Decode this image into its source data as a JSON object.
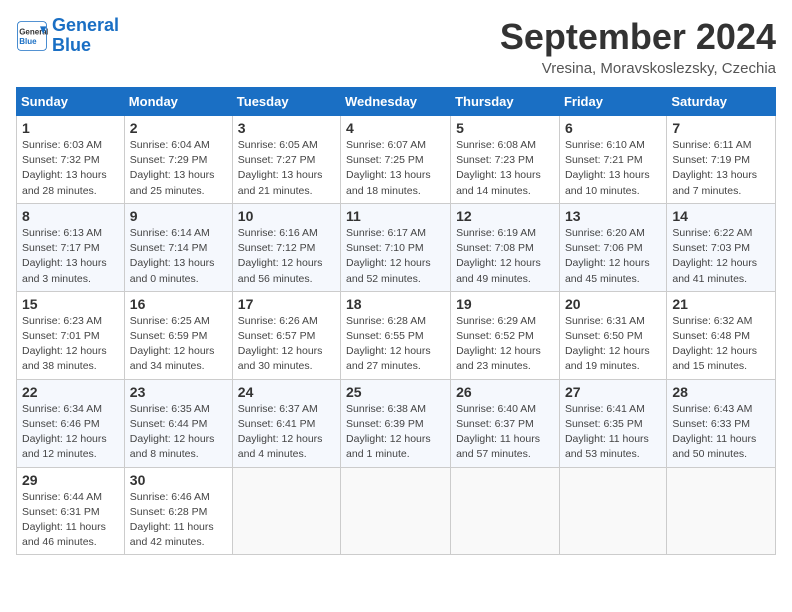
{
  "header": {
    "logo_line1": "General",
    "logo_line2": "Blue",
    "month_year": "September 2024",
    "location": "Vresina, Moravskoslezsky, Czechia"
  },
  "columns": [
    "Sunday",
    "Monday",
    "Tuesday",
    "Wednesday",
    "Thursday",
    "Friday",
    "Saturday"
  ],
  "weeks": [
    [
      {
        "day": "1",
        "info": "Sunrise: 6:03 AM\nSunset: 7:32 PM\nDaylight: 13 hours\nand 28 minutes."
      },
      {
        "day": "2",
        "info": "Sunrise: 6:04 AM\nSunset: 7:29 PM\nDaylight: 13 hours\nand 25 minutes."
      },
      {
        "day": "3",
        "info": "Sunrise: 6:05 AM\nSunset: 7:27 PM\nDaylight: 13 hours\nand 21 minutes."
      },
      {
        "day": "4",
        "info": "Sunrise: 6:07 AM\nSunset: 7:25 PM\nDaylight: 13 hours\nand 18 minutes."
      },
      {
        "day": "5",
        "info": "Sunrise: 6:08 AM\nSunset: 7:23 PM\nDaylight: 13 hours\nand 14 minutes."
      },
      {
        "day": "6",
        "info": "Sunrise: 6:10 AM\nSunset: 7:21 PM\nDaylight: 13 hours\nand 10 minutes."
      },
      {
        "day": "7",
        "info": "Sunrise: 6:11 AM\nSunset: 7:19 PM\nDaylight: 13 hours\nand 7 minutes."
      }
    ],
    [
      {
        "day": "8",
        "info": "Sunrise: 6:13 AM\nSunset: 7:17 PM\nDaylight: 13 hours\nand 3 minutes."
      },
      {
        "day": "9",
        "info": "Sunrise: 6:14 AM\nSunset: 7:14 PM\nDaylight: 13 hours\nand 0 minutes."
      },
      {
        "day": "10",
        "info": "Sunrise: 6:16 AM\nSunset: 7:12 PM\nDaylight: 12 hours\nand 56 minutes."
      },
      {
        "day": "11",
        "info": "Sunrise: 6:17 AM\nSunset: 7:10 PM\nDaylight: 12 hours\nand 52 minutes."
      },
      {
        "day": "12",
        "info": "Sunrise: 6:19 AM\nSunset: 7:08 PM\nDaylight: 12 hours\nand 49 minutes."
      },
      {
        "day": "13",
        "info": "Sunrise: 6:20 AM\nSunset: 7:06 PM\nDaylight: 12 hours\nand 45 minutes."
      },
      {
        "day": "14",
        "info": "Sunrise: 6:22 AM\nSunset: 7:03 PM\nDaylight: 12 hours\nand 41 minutes."
      }
    ],
    [
      {
        "day": "15",
        "info": "Sunrise: 6:23 AM\nSunset: 7:01 PM\nDaylight: 12 hours\nand 38 minutes."
      },
      {
        "day": "16",
        "info": "Sunrise: 6:25 AM\nSunset: 6:59 PM\nDaylight: 12 hours\nand 34 minutes."
      },
      {
        "day": "17",
        "info": "Sunrise: 6:26 AM\nSunset: 6:57 PM\nDaylight: 12 hours\nand 30 minutes."
      },
      {
        "day": "18",
        "info": "Sunrise: 6:28 AM\nSunset: 6:55 PM\nDaylight: 12 hours\nand 27 minutes."
      },
      {
        "day": "19",
        "info": "Sunrise: 6:29 AM\nSunset: 6:52 PM\nDaylight: 12 hours\nand 23 minutes."
      },
      {
        "day": "20",
        "info": "Sunrise: 6:31 AM\nSunset: 6:50 PM\nDaylight: 12 hours\nand 19 minutes."
      },
      {
        "day": "21",
        "info": "Sunrise: 6:32 AM\nSunset: 6:48 PM\nDaylight: 12 hours\nand 15 minutes."
      }
    ],
    [
      {
        "day": "22",
        "info": "Sunrise: 6:34 AM\nSunset: 6:46 PM\nDaylight: 12 hours\nand 12 minutes."
      },
      {
        "day": "23",
        "info": "Sunrise: 6:35 AM\nSunset: 6:44 PM\nDaylight: 12 hours\nand 8 minutes."
      },
      {
        "day": "24",
        "info": "Sunrise: 6:37 AM\nSunset: 6:41 PM\nDaylight: 12 hours\nand 4 minutes."
      },
      {
        "day": "25",
        "info": "Sunrise: 6:38 AM\nSunset: 6:39 PM\nDaylight: 12 hours\nand 1 minute."
      },
      {
        "day": "26",
        "info": "Sunrise: 6:40 AM\nSunset: 6:37 PM\nDaylight: 11 hours\nand 57 minutes."
      },
      {
        "day": "27",
        "info": "Sunrise: 6:41 AM\nSunset: 6:35 PM\nDaylight: 11 hours\nand 53 minutes."
      },
      {
        "day": "28",
        "info": "Sunrise: 6:43 AM\nSunset: 6:33 PM\nDaylight: 11 hours\nand 50 minutes."
      }
    ],
    [
      {
        "day": "29",
        "info": "Sunrise: 6:44 AM\nSunset: 6:31 PM\nDaylight: 11 hours\nand 46 minutes."
      },
      {
        "day": "30",
        "info": "Sunrise: 6:46 AM\nSunset: 6:28 PM\nDaylight: 11 hours\nand 42 minutes."
      },
      {
        "day": "",
        "info": ""
      },
      {
        "day": "",
        "info": ""
      },
      {
        "day": "",
        "info": ""
      },
      {
        "day": "",
        "info": ""
      },
      {
        "day": "",
        "info": ""
      }
    ]
  ]
}
